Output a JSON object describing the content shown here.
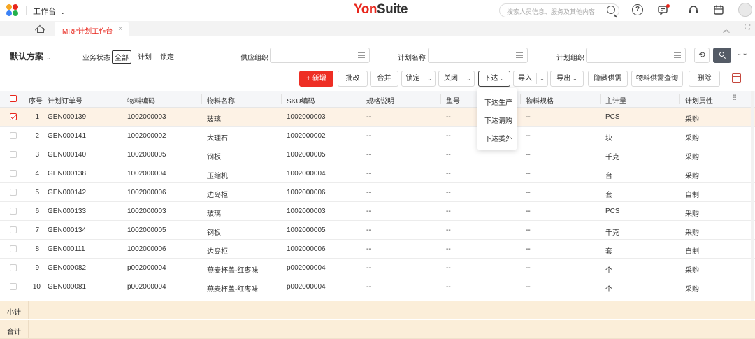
{
  "header": {
    "workbench_label": "工作台",
    "brand_yon": "Yon",
    "brand_suite": "Suite",
    "search_placeholder": "搜索人员信息、服务及其他内容"
  },
  "tabs": {
    "active_label": "MRP计划工作台",
    "close_glyph": "×"
  },
  "filters": {
    "plan_label": "默认方案",
    "status_label": "业务状态",
    "status_options": [
      "全部",
      "计划",
      "锁定"
    ],
    "supply_org_label": "供应组织",
    "plan_name_label": "计划名称",
    "plan_org_label": "计划组织"
  },
  "toolbar": {
    "new_label": "+ 新增",
    "batch_label": "批改",
    "merge_label": "合并",
    "lock_label": "锁定",
    "close_label": "关闭",
    "issue_label": "下达",
    "import_label": "导入",
    "export_label": "导出",
    "hide_supply_label": "隐藏供需",
    "material_query_label": "物料供需查询",
    "delete_label": "删除"
  },
  "dropdown": {
    "items": [
      "下达生产",
      "下达请购",
      "下达委外"
    ]
  },
  "table": {
    "columns": [
      "序号",
      "计划订单号",
      "物料编码",
      "物料名称",
      "SKU编码",
      "规格说明",
      "型号",
      "物料规格",
      "主计量",
      "计划属性"
    ],
    "rows": [
      {
        "idx": "1",
        "order": "GEN000139",
        "code": "1002000003",
        "name": "玻璃",
        "sku": "1002000003",
        "spec": "--",
        "model": "--",
        "mspec": "--",
        "unit": "PCS",
        "attr": "采购",
        "selected": true
      },
      {
        "idx": "2",
        "order": "GEN000141",
        "code": "1002000002",
        "name": "大理石",
        "sku": "1002000002",
        "spec": "--",
        "model": "--",
        "mspec": "--",
        "unit": "块",
        "attr": "采购",
        "selected": false
      },
      {
        "idx": "3",
        "order": "GEN000140",
        "code": "1002000005",
        "name": "钢板",
        "sku": "1002000005",
        "spec": "--",
        "model": "--",
        "mspec": "--",
        "unit": "千克",
        "attr": "采购",
        "selected": false
      },
      {
        "idx": "4",
        "order": "GEN000138",
        "code": "1002000004",
        "name": "压缩机",
        "sku": "1002000004",
        "spec": "--",
        "model": "--",
        "mspec": "--",
        "unit": "台",
        "attr": "采购",
        "selected": false
      },
      {
        "idx": "5",
        "order": "GEN000142",
        "code": "1002000006",
        "name": "边岛柜",
        "sku": "1002000006",
        "spec": "--",
        "model": "--",
        "mspec": "--",
        "unit": "套",
        "attr": "自制",
        "selected": false
      },
      {
        "idx": "6",
        "order": "GEN000133",
        "code": "1002000003",
        "name": "玻璃",
        "sku": "1002000003",
        "spec": "--",
        "model": "--",
        "mspec": "--",
        "unit": "PCS",
        "attr": "采购",
        "selected": false
      },
      {
        "idx": "7",
        "order": "GEN000134",
        "code": "1002000005",
        "name": "钢板",
        "sku": "1002000005",
        "spec": "--",
        "model": "--",
        "mspec": "--",
        "unit": "千克",
        "attr": "采购",
        "selected": false
      },
      {
        "idx": "8",
        "order": "GEN000111",
        "code": "1002000006",
        "name": "边岛柜",
        "sku": "1002000006",
        "spec": "--",
        "model": "--",
        "mspec": "--",
        "unit": "套",
        "attr": "自制",
        "selected": false
      },
      {
        "idx": "9",
        "order": "GEN000082",
        "code": "p002000004",
        "name": "燕麦杯盖-红枣味",
        "sku": "p002000004",
        "spec": "--",
        "model": "--",
        "mspec": "--",
        "unit": "个",
        "attr": "采购",
        "selected": false
      },
      {
        "idx": "10",
        "order": "GEN000081",
        "code": "p002000004",
        "name": "燕麦杯盖-红枣味",
        "sku": "p002000004",
        "spec": "--",
        "model": "--",
        "mspec": "--",
        "unit": "个",
        "attr": "采购",
        "selected": false
      }
    ]
  },
  "summary": {
    "subtotal_label": "小计",
    "total_label": "合计"
  },
  "colors": {
    "accent": "#e8261c",
    "selected_row": "#fdf2e5",
    "summary_bg": "#fbeed9"
  }
}
